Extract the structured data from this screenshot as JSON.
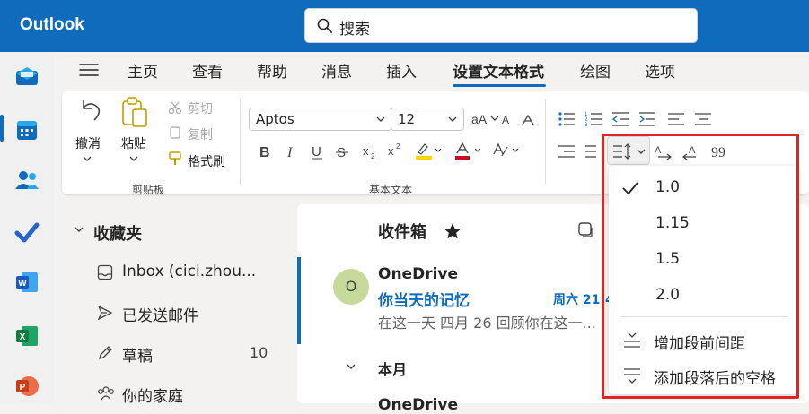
{
  "app": {
    "title": "Outlook"
  },
  "search": {
    "placeholder": "搜索"
  },
  "tabs": [
    "主页",
    "查看",
    "帮助",
    "消息",
    "插入",
    "设置文本格式",
    "绘图",
    "选项"
  ],
  "ribbon": {
    "clipboard": {
      "undo": "撤消",
      "paste": "粘贴",
      "cut": "剪切",
      "copy": "复制",
      "format_painter": "格式刷",
      "group_label": "剪贴板"
    },
    "basic_text": {
      "font": "Aptos",
      "size": "12",
      "group_label": "基本文本"
    }
  },
  "folders": {
    "favorites": "收藏夹",
    "items": [
      {
        "label": "Inbox (cici.zhou...",
        "count": ""
      },
      {
        "label": "已发送邮件",
        "count": ""
      },
      {
        "label": "草稿",
        "count": "10"
      },
      {
        "label": "你的家庭",
        "count": ""
      }
    ]
  },
  "maillist": {
    "title": "收件箱",
    "email": {
      "sender": "OneDrive",
      "avatar": "O",
      "subject": "你当天的记忆",
      "date": "周六 21:4",
      "preview": "在这一天 四月 26 回顾你在这一..."
    },
    "group_header": "本月",
    "next_sender": "OneDrive"
  },
  "spacing_menu": {
    "options": [
      "1.0",
      "1.15",
      "1.5",
      "2.0"
    ],
    "selected": "1.0",
    "actions": [
      "增加段前间距",
      "添加段落后的空格"
    ]
  },
  "colors": {
    "brand": "#0f6cbd",
    "highlight": "#e3231f"
  }
}
